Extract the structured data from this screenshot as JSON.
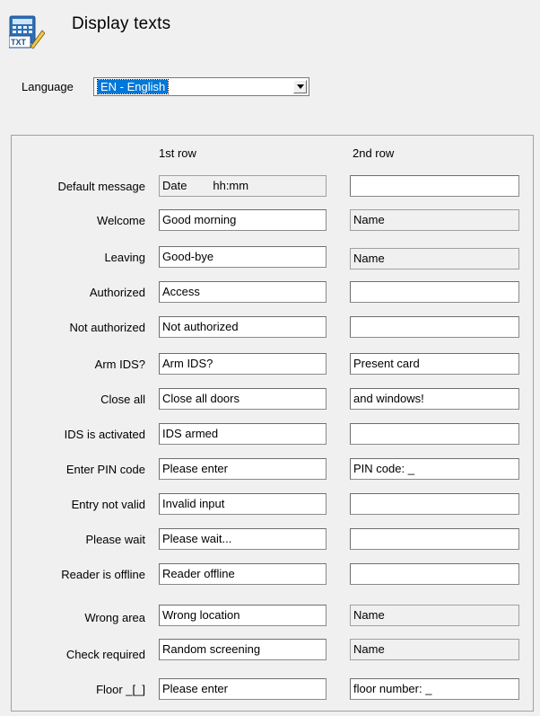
{
  "header": {
    "title": "Display texts",
    "icon": "display-texts-icon",
    "icon_text": "TXT"
  },
  "language": {
    "label": "Language",
    "selected": "EN - English"
  },
  "columns": {
    "first": "1st row",
    "second": "2nd row"
  },
  "rows": [
    {
      "label": "Default message",
      "first": "Date        hh:mm",
      "second": ""
    },
    {
      "label": "Welcome",
      "first": "Good morning",
      "second": "Name"
    },
    {
      "label": "Leaving",
      "first": "Good-bye",
      "second": "Name"
    },
    {
      "label": "Authorized",
      "first": "Access",
      "second": ""
    },
    {
      "label": "Not authorized",
      "first": "Not authorized",
      "second": ""
    },
    {
      "label": "Arm IDS?",
      "first": "Arm IDS?",
      "second": "Present card"
    },
    {
      "label": "Close all",
      "first": "Close all doors",
      "second": "and windows!"
    },
    {
      "label": "IDS is activated",
      "first": "IDS armed",
      "second": ""
    },
    {
      "label": "Enter PIN code",
      "first": "Please enter",
      "second": "PIN code: _"
    },
    {
      "label": "Entry not valid",
      "first": "Invalid input",
      "second": ""
    },
    {
      "label": "Please wait",
      "first": "Please wait...",
      "second": ""
    },
    {
      "label": "Reader is offline",
      "first": "Reader offline",
      "second": ""
    },
    {
      "label": "Wrong area",
      "first": "Wrong location",
      "second": "Name"
    },
    {
      "label": "Check required",
      "first": "Random screening",
      "second": "Name"
    },
    {
      "label": "Floor _[_]",
      "first": "Please enter",
      "second": "floor number: _"
    }
  ]
}
